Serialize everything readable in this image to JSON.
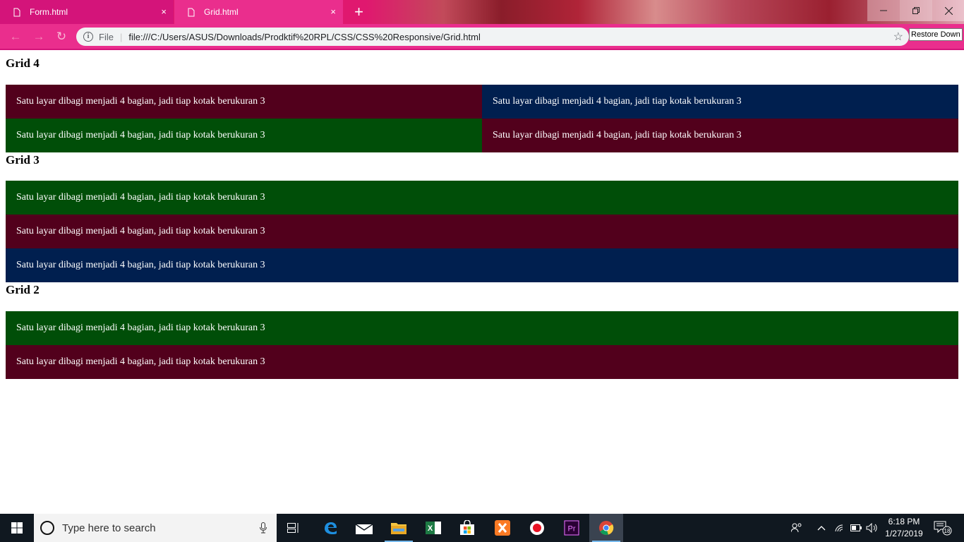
{
  "browser": {
    "tabs": [
      {
        "title": "Form.html",
        "active": false
      },
      {
        "title": "Grid.html",
        "active": true
      }
    ],
    "new_tab_symbol": "+",
    "close_symbol": "×",
    "address": {
      "scheme_label": "File",
      "url": "file:///C:/Users/ASUS/Downloads/Prodktif%20RPL/CSS/CSS%20Responsive/Grid.html"
    },
    "tooltip": "Restore Down",
    "colors": {
      "tab_inactive": "#d4147a",
      "tab_active": "#ea2e8d",
      "toolbar": "#ea2e8d"
    }
  },
  "page": {
    "cell_text": "Satu layar dibagi menjadi 4 bagian, jadi tiap kotak berukuran 3",
    "colors": {
      "maroon": "#52001c",
      "navy": "#001f4f",
      "green": "#004e08"
    },
    "sections": [
      {
        "heading": "Grid 4",
        "cells": [
          {
            "text": "Satu layar dibagi menjadi 4 bagian, jadi tiap kotak berukuran 3",
            "color": "maroon"
          },
          {
            "text": "Satu layar dibagi menjadi 4 bagian, jadi tiap kotak berukuran 3",
            "color": "navy"
          },
          {
            "text": "Satu layar dibagi menjadi 4 bagian, jadi tiap kotak berukuran 3",
            "color": "green"
          },
          {
            "text": "Satu layar dibagi menjadi 4 bagian, jadi tiap kotak berukuran 3",
            "color": "maroon"
          }
        ]
      },
      {
        "heading": "Grid 3",
        "cells": [
          {
            "text": "Satu layar dibagi menjadi 4 bagian, jadi tiap kotak berukuran 3",
            "color": "green"
          },
          {
            "text": "Satu layar dibagi menjadi 4 bagian, jadi tiap kotak berukuran 3",
            "color": "maroon"
          },
          {
            "text": "Satu layar dibagi menjadi 4 bagian, jadi tiap kotak berukuran 3",
            "color": "navy"
          }
        ]
      },
      {
        "heading": "Grid 2",
        "cells": [
          {
            "text": "Satu layar dibagi menjadi 4 bagian, jadi tiap kotak berukuran 3",
            "color": "green"
          },
          {
            "text": "Satu layar dibagi menjadi 4 bagian, jadi tiap kotak berukuran 3",
            "color": "maroon"
          }
        ]
      }
    ]
  },
  "taskbar": {
    "search_placeholder": "Type here to search",
    "apps": [
      "task-view-icon",
      "edge-icon",
      "mail-icon",
      "file-explorer-icon",
      "excel-icon",
      "store-icon",
      "xampp-icon",
      "recorder-icon",
      "premiere-icon",
      "chrome-icon"
    ],
    "premiere_label": "Pr",
    "excel_label": "X",
    "clock": {
      "time": "6:18 PM",
      "date": "1/27/2019"
    },
    "notification_count": "18"
  }
}
